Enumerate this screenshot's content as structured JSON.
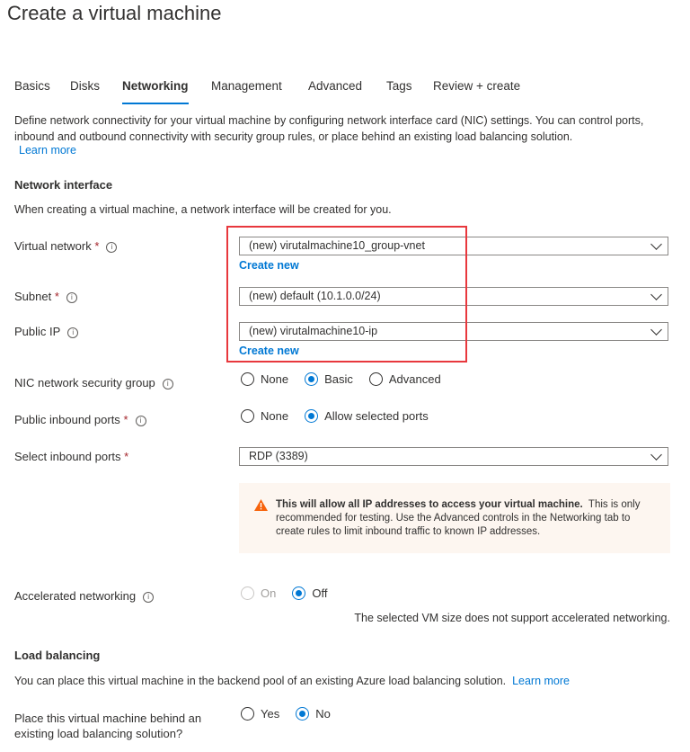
{
  "title": "Create a virtual machine",
  "tabs": [
    "Basics",
    "Disks",
    "Networking",
    "Management",
    "Advanced",
    "Tags",
    "Review + create"
  ],
  "description": "Define network connectivity for your virtual machine by configuring network interface card (NIC) settings. You can control ports, inbound and outbound connectivity with security group rules, or place behind an existing load balancing solution.",
  "learn_more": "Learn more",
  "network_interface": {
    "heading": "Network interface",
    "subtext": "When creating a virtual machine, a network interface will be created for you."
  },
  "fields": {
    "virtual_network": {
      "label": "Virtual network",
      "value": "(new) virutalmachine10_group-vnet",
      "create_new": "Create new"
    },
    "subnet": {
      "label": "Subnet",
      "value": "(new) default (10.1.0.0/24)"
    },
    "public_ip": {
      "label": "Public IP",
      "value": "(new) virutalmachine10-ip",
      "create_new": "Create new"
    },
    "nic_nsg": {
      "label": "NIC network security group",
      "options": [
        "None",
        "Basic",
        "Advanced"
      ],
      "selected": "Basic"
    },
    "public_inbound": {
      "label": "Public inbound ports",
      "options": [
        "None",
        "Allow selected ports"
      ],
      "selected": "Allow selected ports"
    },
    "select_inbound": {
      "label": "Select inbound ports",
      "value": "RDP (3389)"
    },
    "accelerated": {
      "label": "Accelerated networking",
      "options": [
        "On",
        "Off"
      ],
      "selected": "Off",
      "note": "The selected VM size does not support accelerated networking."
    }
  },
  "warning": {
    "bold": "This will allow all IP addresses to access your virtual machine.",
    "text": "This is only recommended for testing.  Use the Advanced controls in the Networking tab to create rules to limit inbound traffic to known IP addresses."
  },
  "load_balancing": {
    "heading": "Load balancing",
    "text": "You can place this virtual machine in the backend pool of an existing Azure load balancing solution.",
    "learn_more": "Learn more",
    "question_line1": "Place this virtual machine behind an",
    "question_line2": "existing load balancing solution?",
    "options": [
      "Yes",
      "No"
    ],
    "selected": "No"
  },
  "required_mark": "*",
  "info_glyph": "i",
  "colors": {
    "accent": "#0078d4",
    "highlight": "#e8383d",
    "warning": "#f7630c"
  }
}
